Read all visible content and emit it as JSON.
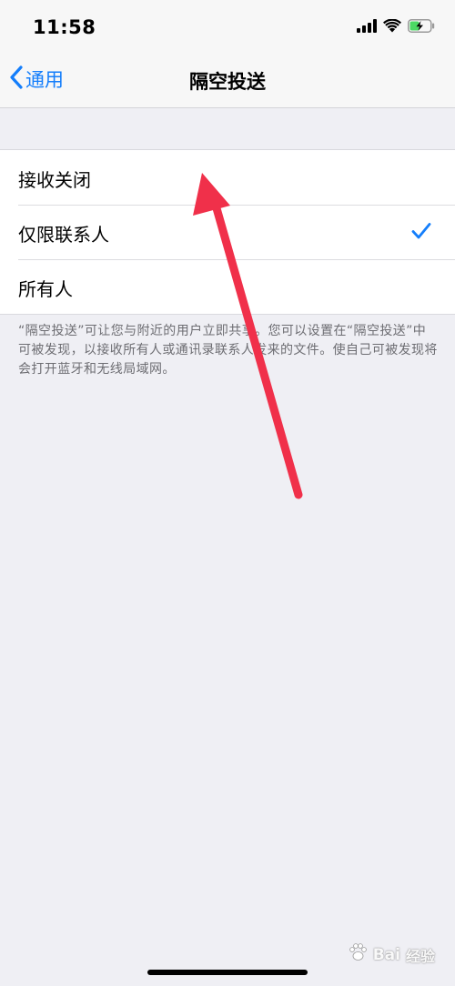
{
  "status_bar": {
    "time": "11:58",
    "icons": [
      "signal-icon",
      "wifi-icon",
      "battery-charging-icon"
    ]
  },
  "nav": {
    "back_label": "通用",
    "title": "隔空投送"
  },
  "options": [
    {
      "label": "接收关闭",
      "selected": false
    },
    {
      "label": "仅限联系人",
      "selected": true
    },
    {
      "label": "所有人",
      "selected": false
    }
  ],
  "footer_note": "“隔空投送”可让您与附近的用户立即共享。您可以设置在“隔空投送”中可被发现，以接收所有人或通讯录联系人发来的文件。使自己可被发现将会打开蓝牙和无线局域网。",
  "colors": {
    "accent": "#147efb",
    "annotation_arrow": "#f0304a",
    "background": "#efeff4"
  },
  "watermark": {
    "logo_text": "Bai",
    "sub_text": "经验"
  }
}
